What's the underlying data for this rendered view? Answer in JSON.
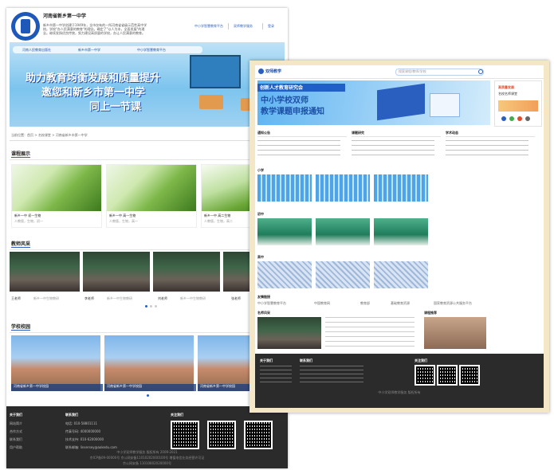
{
  "left_page": {
    "school_name": "河南省新乡第一中学",
    "intro_lines": [
      "新乡市第一中学创建于1949年，全市仅有的一所河南省省级示范性高中学",
      "校。学校\"办人民满意的教育\"的理念。确定了\"以人为本，全面发展\"的理",
      "念。继续发扬优良传统，努力建设高质量的学校，办让人民满意的教育。"
    ],
    "header_links": [
      "中小学智慧教育平台",
      "双师教学服务",
      "登录"
    ],
    "banner_logos": [
      "河南人民教育出版社",
      "新乡市第一中学",
      "中小学智慧教育平台"
    ],
    "banner_title": [
      "助力教育均衡发展和质量提升",
      "邀您和新乡市第一中学",
      "同上一节课"
    ],
    "breadcrumb": "当前位置：首页 > 名校课堂 > 河南省新乡市第一中学",
    "sections": {
      "courses": "课程展示",
      "teachers": "教师风采",
      "campus": "学校校园"
    },
    "courses": [
      {
        "title": "新乡一中 初一生物",
        "sub": "人教版，生物，初一"
      },
      {
        "title": "新乡一中 高一生物",
        "sub": "人教版，生物，高一"
      },
      {
        "title": "新乡一中 高二生物",
        "sub": "人教版，生物，高二"
      }
    ],
    "teachers": [
      {
        "name": "王老师",
        "school": "新乡一中生物教研"
      },
      {
        "name": "李老师",
        "school": "新乡一中生物教研"
      },
      {
        "name": "刘老师",
        "school": "新乡一中生物教研"
      },
      {
        "name": "张老师",
        "school": ""
      }
    ],
    "campus": [
      {
        "caption": "河南省新乡第一中学校园"
      },
      {
        "caption": "河南省新乡第一中学校园"
      },
      {
        "caption": "河南省新乡第一中学校园"
      }
    ],
    "footer": {
      "col1_title": "关于我们",
      "col1": [
        "网站简介",
        "合作方式",
        "联系我们",
        "用户帮助"
      ],
      "col2_title": "联系我们",
      "col2": [
        "电话: 010-58801111",
        "传真号码: 4000000000",
        "技术支持: 010-62000000",
        "联系邮箱: linsersey@aokedu.com"
      ],
      "col3_title": "关注我们",
      "bottom": [
        "中小学双师教学服务 版权所有 2009-2021",
        "京ICP备09-00000号  京公网安备11010202000100号  增值电信业务经营许可证",
        "京公网安备 11010802020000号"
      ]
    }
  },
  "right_page": {
    "brand": "双师教学",
    "search_placeholder": "搜索课程/教师/学校",
    "banner_lines": [
      "创新人才教育研究会",
      "中小学校双师",
      "教学课题申报通知"
    ],
    "side_card": [
      "高质量发展",
      "名校名师课堂"
    ],
    "news_cols": [
      "通知公告",
      "课题研究",
      "学术动态"
    ],
    "row_titles": [
      "小学",
      "初中",
      "高中"
    ],
    "links_title": "友情链接",
    "links": [
      "中小学智慧教育平台",
      "中国教育网",
      "教育部",
      "基础教育资源",
      "国家教育资源公共服务平台"
    ],
    "bottom_titles": [
      "名师风采",
      "课程推荐"
    ],
    "footer_cols": [
      "关于我们",
      "联系我们",
      "关注我们"
    ],
    "footer_copy": "中小学双师教学服务 版权所有"
  }
}
